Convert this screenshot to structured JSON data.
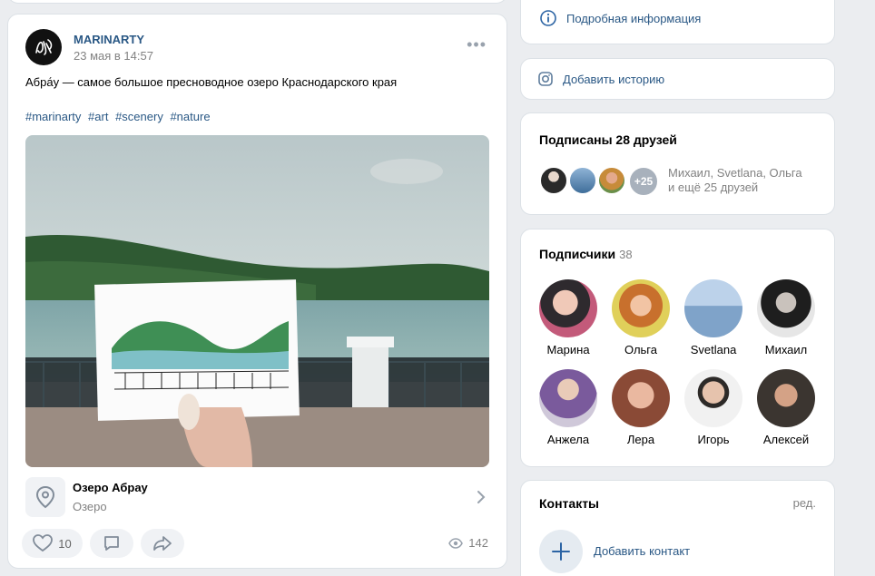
{
  "post": {
    "author": "MARINARTY",
    "date": "23 мая в 14:57",
    "text": "Абра́у — самое большое пресноводное озеро Краснодарского края",
    "hashtags": [
      "#marinarty",
      "#art",
      "#scenery",
      "#nature"
    ],
    "place_title": "Озеро Абрау",
    "place_subtitle": "Озеро",
    "likes": "10",
    "views": "142"
  },
  "sidebar": {
    "info_link": "Подробная информация",
    "story_link": "Добавить историю",
    "friends": {
      "title": "Подписаны 28 друзей",
      "more_badge": "+25",
      "names_line1": "Михаил, Svetlana, Ольга",
      "names_line2": "и ещё 25 друзей"
    },
    "subscribers": {
      "title": "Подписчики",
      "count": "38",
      "people": [
        {
          "name": "Марина",
          "color": "#6b3f4a"
        },
        {
          "name": "Ольга",
          "color": "#c98a3a"
        },
        {
          "name": "Svetlana",
          "color": "#7fa3c9"
        },
        {
          "name": "Михаил",
          "color": "#3a3a3a"
        },
        {
          "name": "Анжела",
          "color": "#8d6fb0"
        },
        {
          "name": "Лера",
          "color": "#a46a55"
        },
        {
          "name": "Игорь",
          "color": "#d9d4cf"
        },
        {
          "name": "Алексей",
          "color": "#5a5048"
        }
      ]
    },
    "contacts": {
      "title": "Контакты",
      "edit": "ред.",
      "add": "Добавить контакт"
    }
  },
  "colors": {
    "link": "#2a5885",
    "muted": "#828282",
    "accent": "#2c64a4"
  }
}
